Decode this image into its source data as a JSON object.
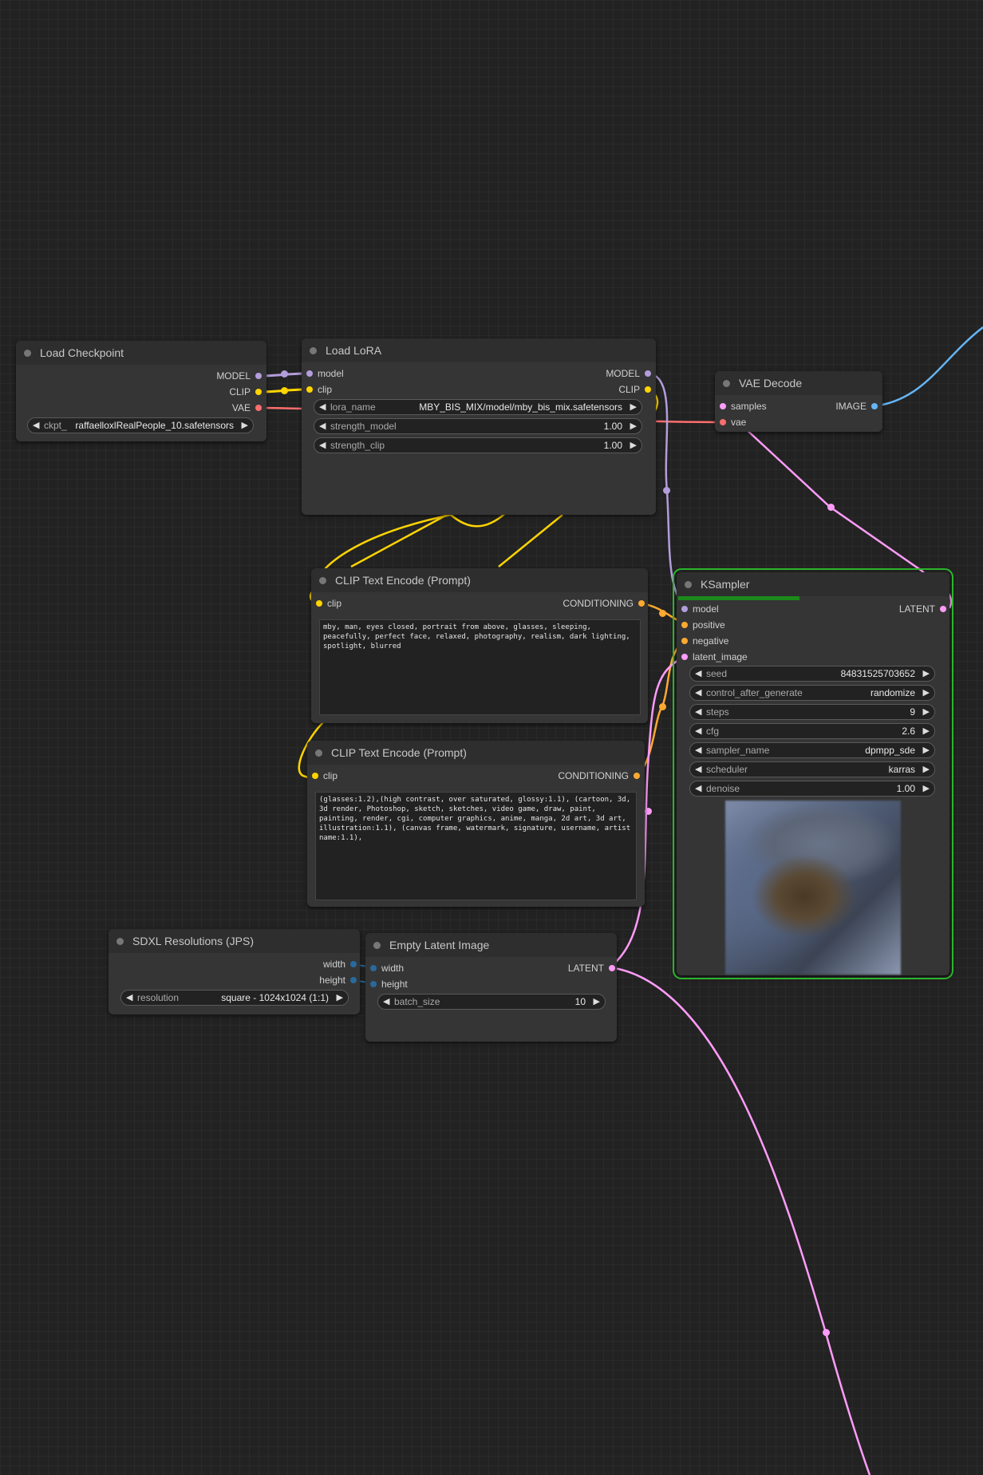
{
  "colors": {
    "model": "#b39ddb",
    "clip": "#ffd500",
    "vae": "#ff6e6e",
    "conditioning": "#ffa931",
    "latent": "#ff9cf9",
    "image": "#64b5f6",
    "int": "#29699c",
    "selected": "#2bb52b"
  },
  "nodes": {
    "load_checkpoint": {
      "title": "Load Checkpoint",
      "outputs": [
        "MODEL",
        "CLIP",
        "VAE"
      ],
      "widget": {
        "name": "ckpt_",
        "value": "raffaelloxlRealPeople_10.safetensors"
      }
    },
    "load_lora": {
      "title": "Load LoRA",
      "inputs": [
        "model",
        "clip"
      ],
      "outputs": [
        "MODEL",
        "CLIP"
      ],
      "widgets": [
        {
          "name": "lora_name",
          "value": "MBY_BIS_MIX/model/mby_bis_mix.safetensors"
        },
        {
          "name": "strength_model",
          "value": "1.00"
        },
        {
          "name": "strength_clip",
          "value": "1.00"
        }
      ]
    },
    "vae_decode": {
      "title": "VAE Decode",
      "inputs": [
        "samples",
        "vae"
      ],
      "outputs": [
        "IMAGE"
      ]
    },
    "clip_positive": {
      "title": "CLIP Text Encode (Prompt)",
      "input": "clip",
      "output": "CONDITIONING",
      "text": "mby, man, eyes closed, portrait from above, glasses, sleeping, peacefully, perfect face, relaxed, photography, realism, dark lighting, spotlight, blurred"
    },
    "clip_negative": {
      "title": "CLIP Text Encode (Prompt)",
      "input": "clip",
      "output": "CONDITIONING",
      "text": "(glasses:1.2),(high contrast, over saturated, glossy:1.1), (cartoon, 3d, 3d render, Photoshop, sketch, sketches, video game, draw, paint, painting, render, cgi, computer graphics, anime, manga, 2d art, 3d art, illustration:1.1), (canvas frame, watermark, signature, username, artist name:1.1),"
    },
    "ksampler": {
      "title": "KSampler",
      "inputs": [
        "model",
        "positive",
        "negative",
        "latent_image"
      ],
      "output": "LATENT",
      "progress": 0.45,
      "widgets": [
        {
          "name": "seed",
          "value": "84831525703652"
        },
        {
          "name": "control_after_generate",
          "value": "randomize"
        },
        {
          "name": "steps",
          "value": "9"
        },
        {
          "name": "cfg",
          "value": "2.6"
        },
        {
          "name": "sampler_name",
          "value": "dpmpp_sde"
        },
        {
          "name": "scheduler",
          "value": "karras"
        },
        {
          "name": "denoise",
          "value": "1.00"
        }
      ]
    },
    "sdxl_resolutions": {
      "title": "SDXL Resolutions (JPS)",
      "outputs": [
        "width",
        "height"
      ],
      "widget": {
        "name": "resolution",
        "value": "square - 1024x1024 (1:1)"
      }
    },
    "empty_latent": {
      "title": "Empty Latent Image",
      "inputs": [
        "width",
        "height"
      ],
      "output": "LATENT",
      "widget": {
        "name": "batch_size",
        "value": "10"
      }
    }
  }
}
